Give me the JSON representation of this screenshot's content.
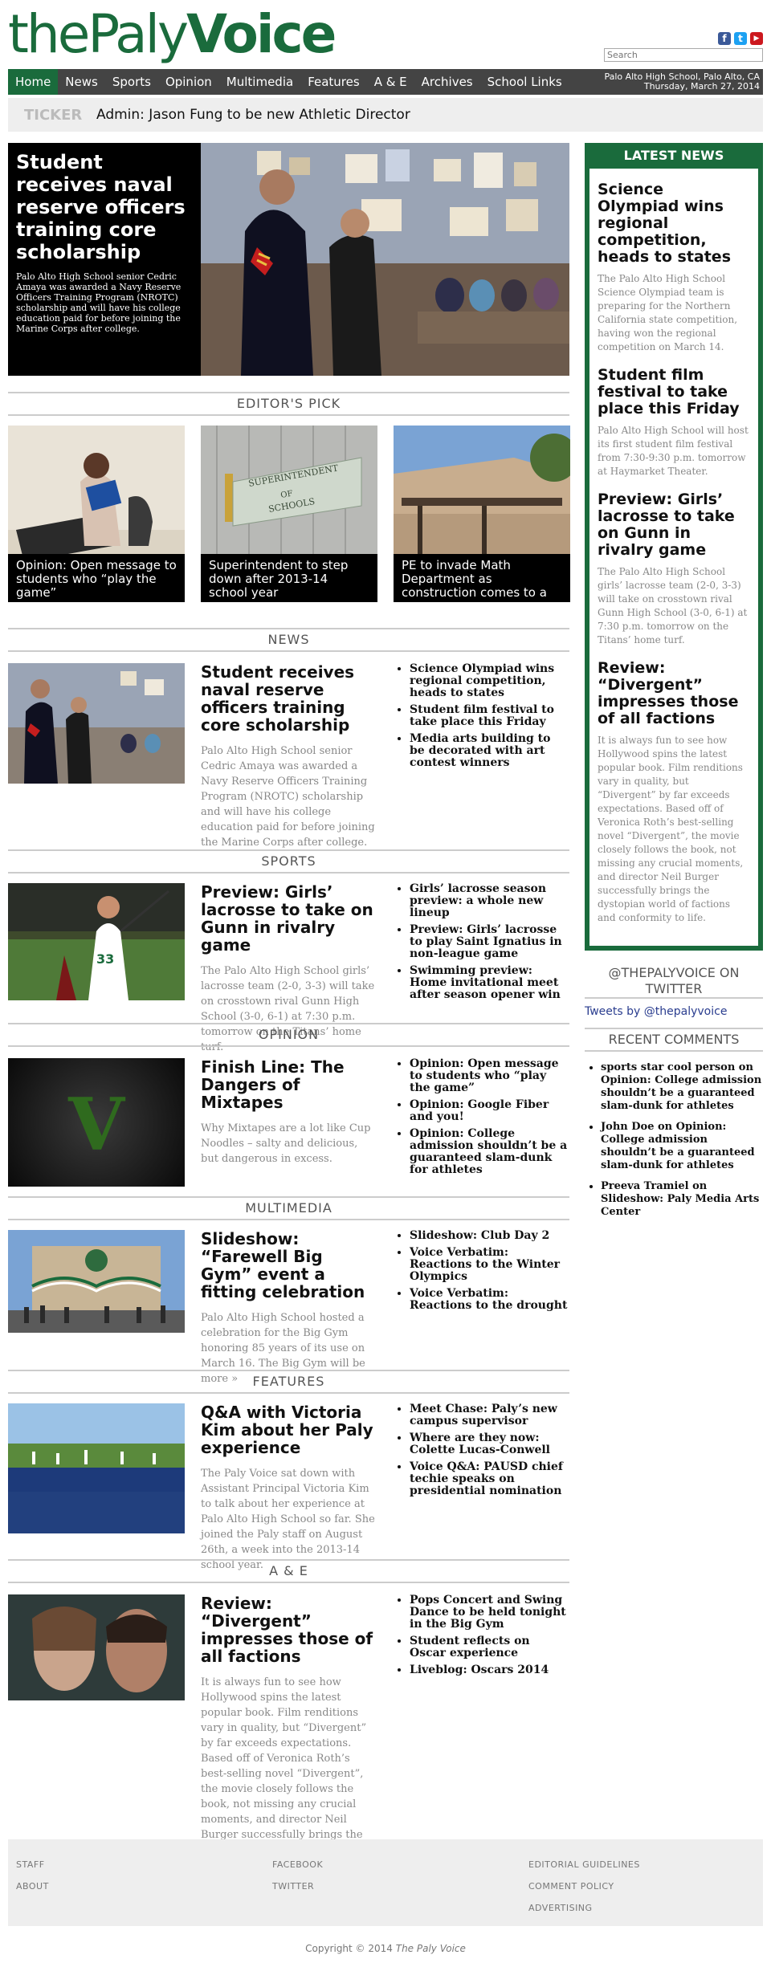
{
  "site": {
    "logo_left": "the",
    "logo_mid": "Paly",
    "logo_right": "Voice",
    "search_placeholder": "Search"
  },
  "social": {
    "facebook": "f",
    "twitter": "t",
    "youtube": "▶"
  },
  "nav": {
    "items": [
      "Home",
      "News",
      "Sports",
      "Opinion",
      "Multimedia",
      "Features",
      "A & E",
      "Archives",
      "School Links"
    ],
    "location": "Palo Alto High School, Palo Alto, CA",
    "date": "Thursday, March 27, 2014"
  },
  "ticker": {
    "label": "TICKER",
    "text": "Admin: Jason Fung to be new Athletic Director"
  },
  "hero": {
    "title": "Student receives naval reserve officers training core scholarship",
    "excerpt": "Palo Alto High School senior Cedric Amaya was awarded a Navy Reserve Officers Training Program (NROTC) scholarship and will have his college education paid for before joining the Marine Corps after college."
  },
  "editors_pick": {
    "heading": "EDITOR'S PICK",
    "items": [
      "Opinion: Open message to students who “play the game”",
      "Superintendent to step down after 2013-14 school year",
      "PE to invade Math Department as construction comes to a"
    ],
    "sign_text": "SUPERINTENDENT OF SCHOOLS"
  },
  "sections": [
    {
      "heading": "NEWS",
      "title": "Student receives naval reserve officers training core scholarship",
      "excerpt": "Palo Alto High School senior Cedric Amaya was awarded a Navy Reserve Officers Training Program (NROTC) scholarship and will have his college education paid for before joining the Marine Corps after college.",
      "links": [
        "Science Olympiad wins regional competition, heads to states",
        "Student film festival to take place this Friday",
        "Media arts building to be decorated with art contest winners"
      ]
    },
    {
      "heading": "SPORTS",
      "title": "Preview: Girls’ lacrosse to take on Gunn in rivalry game",
      "excerpt": "The Palo Alto High School girls’ lacrosse team (2-0, 3-3) will take on crosstown rival Gunn High School (3-0, 6-1) at 7:30 p.m. tomorrow on the Titans’ home turf.",
      "links": [
        "Girls’ lacrosse season preview: a whole new lineup",
        "Preview: Girls’ lacrosse to play Saint Ignatius in non-league game",
        "Swimming preview: Home invitational meet after season opener win"
      ]
    },
    {
      "heading": "OPINION",
      "title": "Finish Line: The Dangers of Mixtapes",
      "excerpt": "Why Mixtapes are a lot like Cup Noodles – salty and delicious, but dangerous in excess.",
      "links": [
        "Opinion: Open message to students who “play the game”",
        "Opinion: Google Fiber and you!",
        "Opinion: College admission shouldn’t be a guaranteed slam-dunk for athletes"
      ],
      "thumb_letter": "V"
    },
    {
      "heading": "MULTIMEDIA",
      "title": "Slideshow: “Farewell Big Gym” event a fitting celebration",
      "excerpt": "Palo Alto High School hosted a celebration for the Big Gym honoring 85 years of its use on March 16. The Big Gym will be",
      "more": "more »",
      "links": [
        "Slideshow: Club Day 2",
        "Voice Verbatim: Reactions to the Winter Olympics",
        "Voice Verbatim: Reactions to the drought"
      ]
    },
    {
      "heading": "FEATURES",
      "title": "Q&A with Victoria Kim about her Paly experience",
      "excerpt": "The Paly Voice sat down with Assistant Principal Victoria Kim to talk about her experience at Palo Alto High School so far. She joined the Paly staff on August 26th, a week into the 2013-14 school year.",
      "links": [
        "Meet Chase: Paly’s new campus supervisor",
        "Where are they now: Colette Lucas-Conwell",
        "Voice Q&A: PAUSD chief techie speaks on presidential nomination"
      ]
    },
    {
      "heading": "A & E",
      "title": "Review: “Divergent” impresses those of all factions",
      "excerpt": "It is always fun to see how Hollywood spins the latest popular book. Film renditions vary in quality, but “Divergent” by far exceeds expectations. Based off of Veronica Roth’s best-selling novel “Divergent”, the movie closely follows the book, not missing any crucial moments, and director Neil Burger successfully brings the dystopian world of factions and conformity to life.",
      "links": [
        "Pops Concert and Swing Dance to be held tonight in the Big Gym",
        "Student reflects on Oscar experience",
        "Liveblog: Oscars 2014"
      ]
    }
  ],
  "sidebar": {
    "heading": "LATEST NEWS",
    "items": [
      {
        "title": "Science Olympiad wins regional competition, heads to states",
        "excerpt": "The Palo Alto High School Science Olympiad team is preparing for the Northern California state competition, having won the regional competition on March 14."
      },
      {
        "title": "Student film festival to take place this Friday",
        "excerpt": "Palo Alto High School will host its first student film festival from 7:30-9:30 p.m. tomorrow at Haymarket Theater."
      },
      {
        "title": "Preview: Girls’ lacrosse to take on Gunn in rivalry game",
        "excerpt": "The Palo Alto High School girls’ lacrosse team (2-0, 3-3) will take on crosstown rival Gunn High School (3-0, 6-1) at 7:30 p.m. tomorrow on the Titans’ home turf."
      },
      {
        "title": "Review: “Divergent” impresses those of all factions",
        "excerpt": "It is always fun to see how Hollywood spins the latest popular book. Film renditions vary in quality, but “Divergent” by far exceeds expectations. Based off of Veronica Roth’s best-selling novel “Divergent”, the movie closely follows the book, not missing any crucial moments, and director Neil Burger successfully brings the dystopian world of factions and conformity to life."
      }
    ],
    "twitter_heading": "@THEPALYVOICE ON TWITTER",
    "twitter_link": "Tweets by @thepalyvoice",
    "comments_heading": "RECENT COMMENTS",
    "comments": [
      {
        "author": "sports star cool person",
        "on": " on ",
        "post": "Opinion: College admission shouldn’t be a guaranteed slam-dunk for athletes"
      },
      {
        "author": "John Doe",
        "on": " on ",
        "post": "Opinion: College admission shouldn’t be a guaranteed slam-dunk for athletes"
      },
      {
        "author": "Preeva Tramiel",
        "on": " on ",
        "post": "Slideshow: Paly Media Arts Center"
      }
    ]
  },
  "footer": {
    "col1": [
      "STAFF",
      "ABOUT"
    ],
    "col2": [
      "FACEBOOK",
      "TWITTER"
    ],
    "col3": [
      "EDITORIAL GUIDELINES",
      "COMMENT POLICY",
      "ADVERTISING"
    ],
    "copyright": "Copyright © 2014",
    "copyright_site": "The Paly Voice"
  },
  "colors": {
    "brand_green": "#1a6b3c",
    "nav_bg": "#444444"
  }
}
